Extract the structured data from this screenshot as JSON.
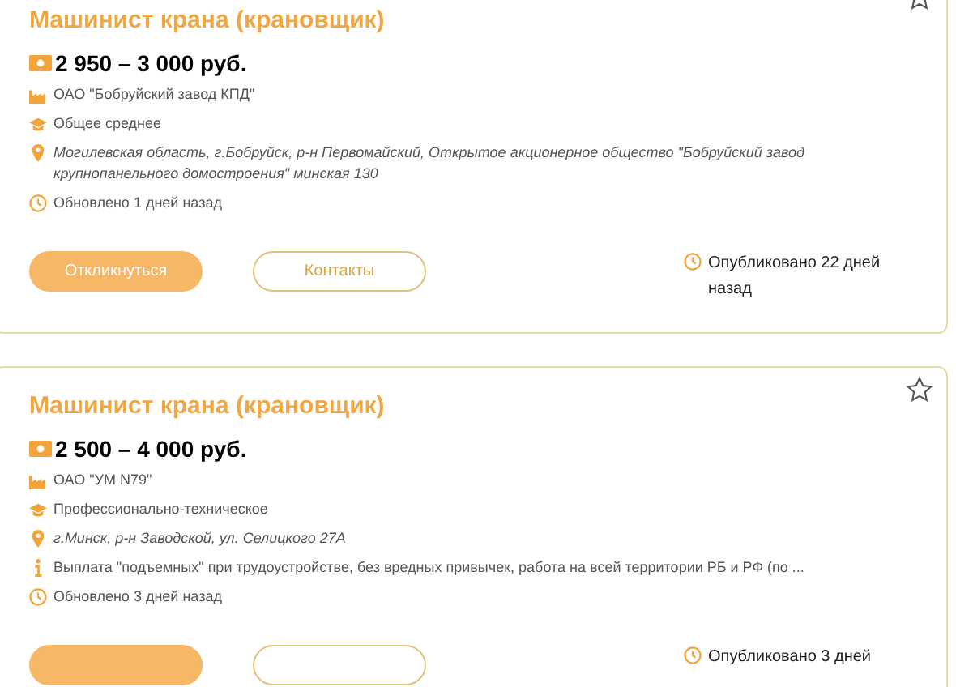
{
  "vacancies": [
    {
      "title": "Машинист крана (крановщик)",
      "bookmarked": false,
      "salary": "2 950 – 3 000 руб.",
      "details": [
        {
          "kind": "company",
          "text": "ОАО \"Бобруйский завод КПД\""
        },
        {
          "kind": "education",
          "text": "Общее среднее"
        },
        {
          "kind": "location",
          "text": "Могилевская область, г.Бобруйск, р-н Первомайский, Открытое акционерное общество \"Бобруйский завод крупнопанельного домостроения\" минская 130"
        },
        {
          "kind": "updated",
          "text": "Обновлено 1 дней назад"
        }
      ],
      "buttons": [
        {
          "kind": "respond",
          "label": "Откликнуться"
        },
        {
          "kind": "contacts",
          "label": "Контакты"
        }
      ],
      "published": "Опубликовано 22 дней назад"
    },
    {
      "title": "Машинист крана (крановщик)",
      "bookmarked": false,
      "salary": "2 500 – 4 000 руб.",
      "details": [
        {
          "kind": "company",
          "text": "ОАО \"УМ N79\""
        },
        {
          "kind": "education",
          "text": "Профессионально-техническое"
        },
        {
          "kind": "location",
          "text": "г.Минск, р-н Заводской, ул. Селицкого 27А"
        },
        {
          "kind": "info",
          "text": "Выплата \"подъемных\" при трудоустройстве, без вредных привычек, работа на всей территории РБ и РФ (по ..."
        },
        {
          "kind": "updated",
          "text": "Обновлено 3 дней назад"
        }
      ],
      "buttons": [
        {
          "kind": "respond"
        },
        {
          "kind": "contacts"
        }
      ],
      "published": "Опубликовано 3 дней"
    }
  ]
}
